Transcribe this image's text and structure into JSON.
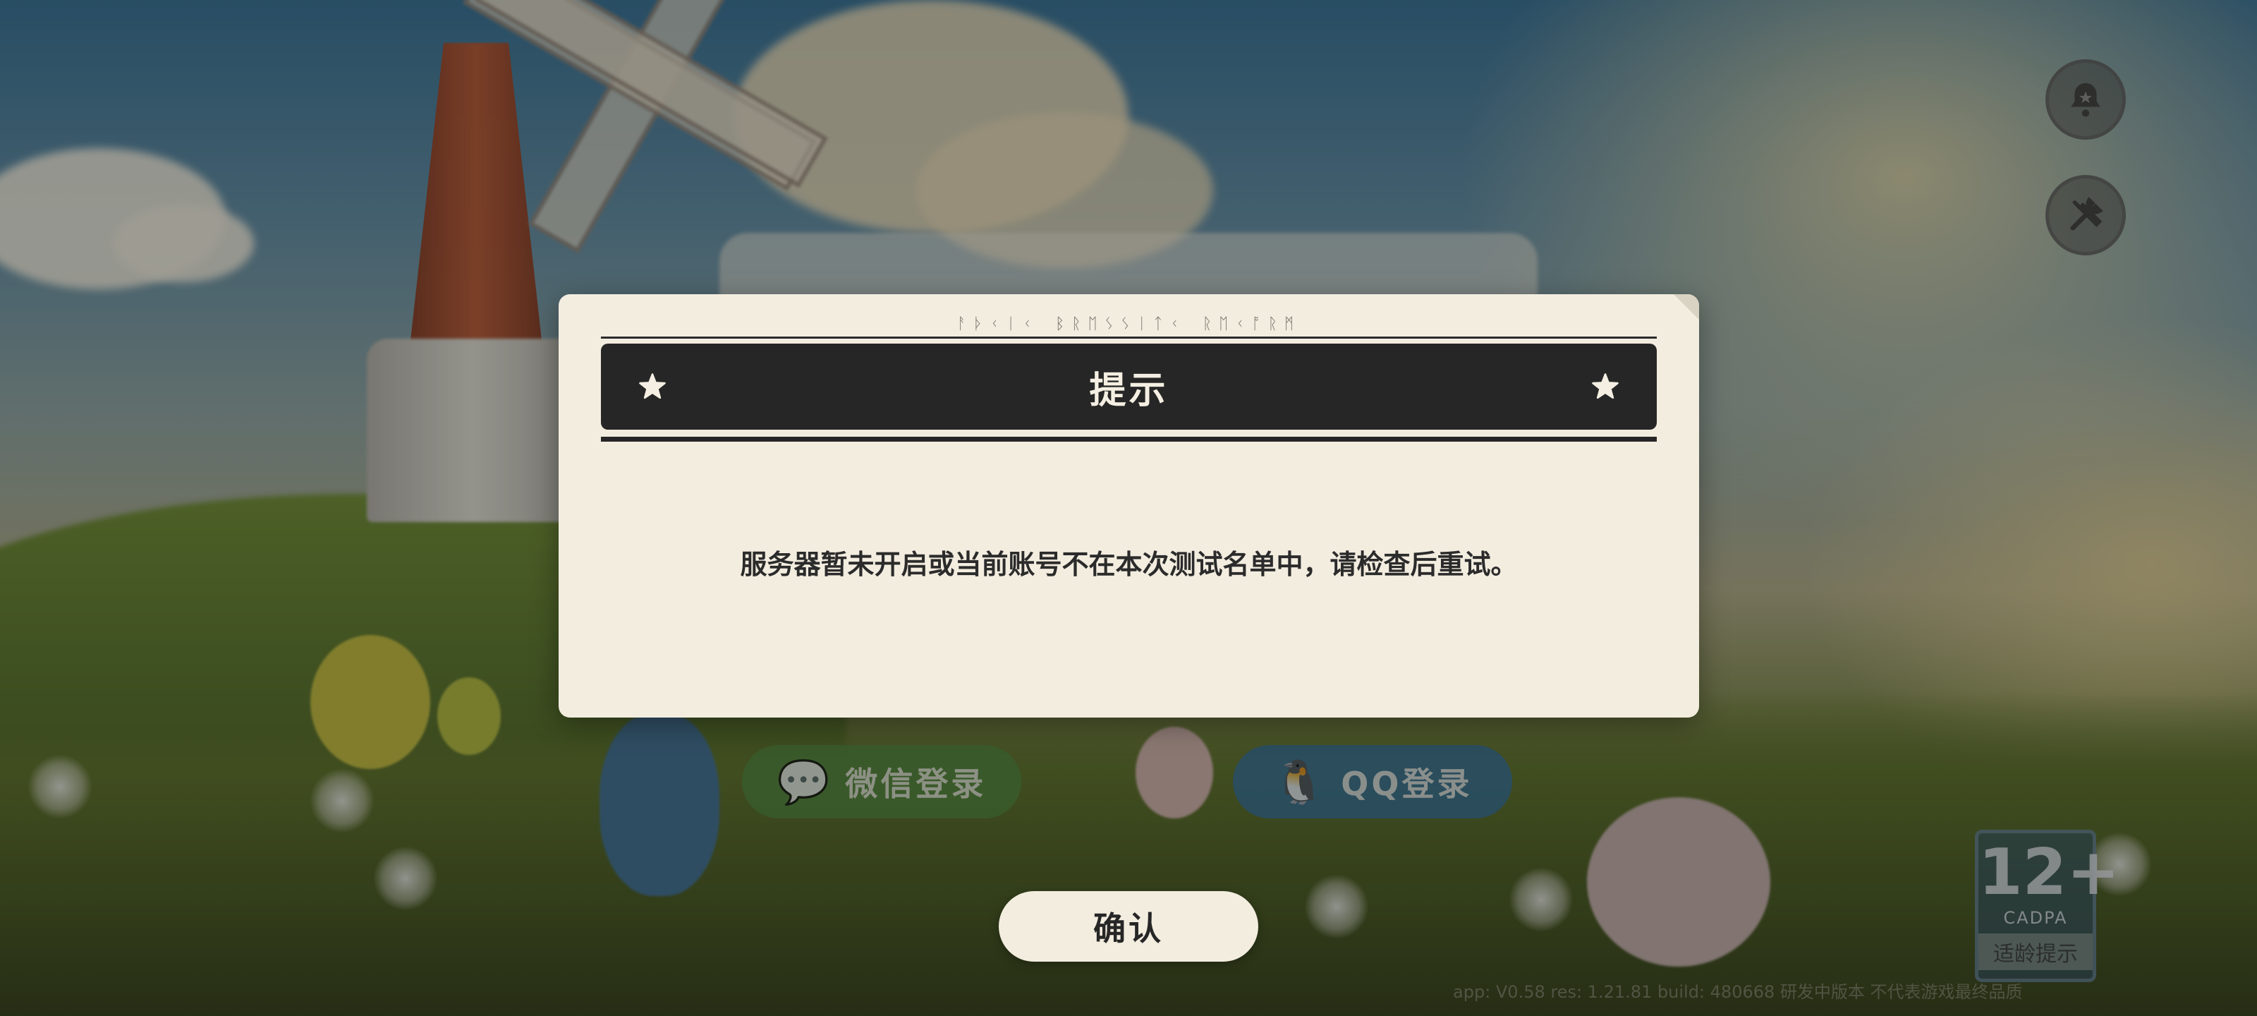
{
  "dialog": {
    "rune_text": "ᚨᚦᚲᛁᚲ ᛒᚱᛖᛊᛊᛁᛏᚲ ᚱᛖᚲᚩᚱᛗ",
    "title": "提示",
    "message": "服务器暂未开启或当前账号不在本次测试名单中，请检查后重试。",
    "title_star_icon": "star-icon"
  },
  "confirm_button": {
    "label": "确认"
  },
  "login": {
    "wechat_label": "微信登录",
    "qq_label": "QQ登录",
    "wechat_color": "#4c8a3a",
    "qq_color": "#2e6f9c"
  },
  "corner_buttons": {
    "notice_icon": "bell-icon",
    "settings_icon": "wrench-screwdriver-icon"
  },
  "age_rating": {
    "number": "12+",
    "org": "CADPA",
    "caption": "适龄提示"
  },
  "version_text": "app: V0.58  res: 1.21.81  build: 480668  研发中版本 不代表游戏最终品质",
  "colors": {
    "dialog_bg": "#f3ede0",
    "title_bar_bg": "#262626",
    "text_dark": "#2b2b2b"
  }
}
